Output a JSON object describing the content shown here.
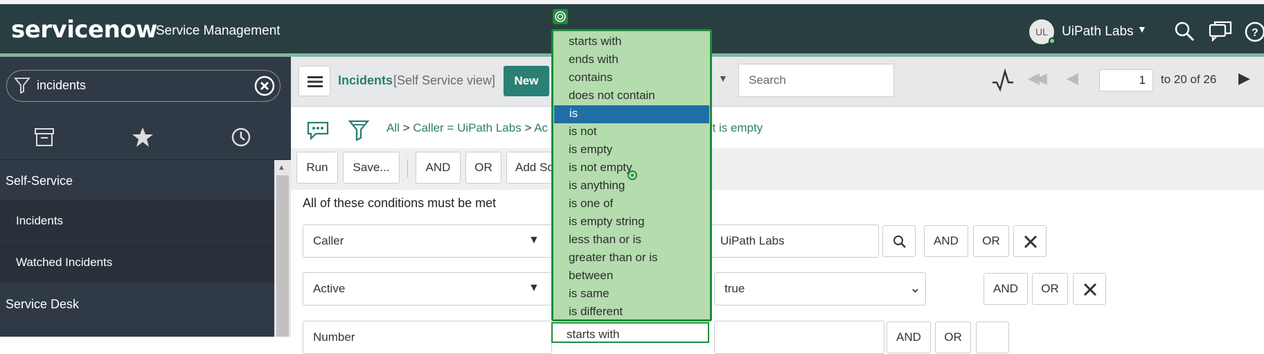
{
  "topbar": {
    "logo": "servicenow",
    "app_title": "Service Management",
    "user_initials": "UL",
    "user_name": "UiPath Labs",
    "icons": [
      "search-icon",
      "chat-icon",
      "help-icon"
    ]
  },
  "sidebar": {
    "filter_value": "incidents",
    "tabs": [
      "archive-icon",
      "star-icon",
      "history-icon"
    ],
    "items": [
      {
        "type": "section",
        "label": "Self-Service"
      },
      {
        "type": "item",
        "label": "Incidents"
      },
      {
        "type": "item",
        "label": "Watched Incidents"
      },
      {
        "type": "section",
        "label": "Service Desk"
      }
    ]
  },
  "list_header": {
    "title": "Incidents",
    "view": "[Self Service view]",
    "new_label": "New",
    "search_placeholder": "Search",
    "page_value": "1",
    "page_range": "to 20 of 26"
  },
  "breadcrumb": {
    "all": "All",
    "sep": ">",
    "caller": "Caller = UiPath Labs",
    "active_partial": "Ac",
    "tail": "st is empty"
  },
  "filter_toolbar": {
    "run": "Run",
    "save": "Save...",
    "and": "AND",
    "or": "OR",
    "add_sort": "Add So"
  },
  "conditions": {
    "label": "All of these conditions must be met",
    "rows": [
      {
        "field": "Caller",
        "value": "UiPath Labs",
        "and": "AND",
        "or": "OR"
      },
      {
        "field": "Active",
        "value": "true",
        "and": "AND",
        "or": "OR"
      },
      {
        "field": "Number",
        "operator": "starts with",
        "and": "AND",
        "or": "OR"
      }
    ]
  },
  "operator_dropdown": {
    "options": [
      "starts with",
      "ends with",
      "contains",
      "does not contain",
      "is",
      "is not",
      "is empty",
      "is not empty",
      "is anything",
      "is one of",
      "is empty string",
      "less than or is",
      "greater than or is",
      "between",
      "is same",
      "is different"
    ],
    "selected": "is"
  },
  "colors": {
    "topbar": "#293e40",
    "accent": "#81b5a1",
    "link": "#2a7f6f",
    "dropdown_bg": "#b4dcae",
    "dropdown_border": "#1e8c3a",
    "selected_bg": "#1f6fa5"
  }
}
